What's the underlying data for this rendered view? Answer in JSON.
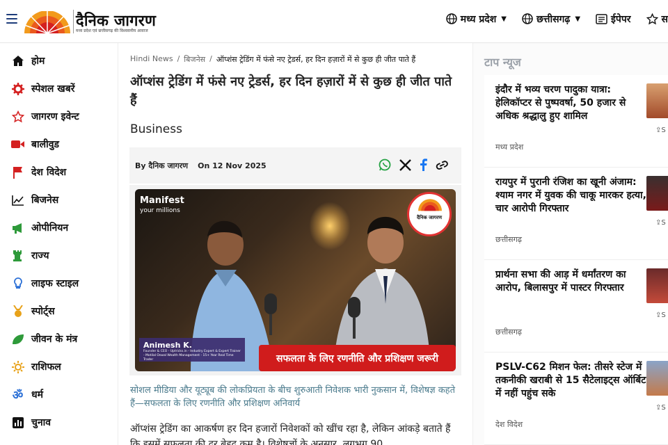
{
  "header": {
    "logo_text": "दैनिक जागरण",
    "logo_tagline": "मध्य प्रदेश एवं छत्तीसगढ़ की विश्वसनीय आवाज",
    "nav": [
      {
        "label": "मध्य प्रदेश",
        "icon": "globe-icon",
        "dropdown": true
      },
      {
        "label": "छत्तीसगढ़",
        "icon": "globe-icon",
        "dropdown": true
      },
      {
        "label": "ईपेपर",
        "icon": "newspaper-icon",
        "dropdown": false
      },
      {
        "label": "स",
        "icon": "star-icon",
        "dropdown": false
      }
    ]
  },
  "sidebar": {
    "items": [
      {
        "label": "होम",
        "icon": "home-icon",
        "color": "#111111"
      },
      {
        "label": "स्पेशल खबरें",
        "icon": "gear-icon",
        "color": "#d42020"
      },
      {
        "label": "जागरण इवेन्ट",
        "icon": "star-icon",
        "color": "#d42020"
      },
      {
        "label": "बालीवुड",
        "icon": "video-icon",
        "color": "#d42020"
      },
      {
        "label": "देश विदेश",
        "icon": "flag-icon",
        "color": "#d42020"
      },
      {
        "label": "बिजनेस",
        "icon": "chart-icon",
        "color": "#111111"
      },
      {
        "label": "ओपीनियन",
        "icon": "megaphone-icon",
        "color": "#2e9a3a"
      },
      {
        "label": "राज्य",
        "icon": "chess-icon",
        "color": "#2e9a3a"
      },
      {
        "label": "लाइफ स्टाइल",
        "icon": "bulb-icon",
        "color": "#2a6fd6"
      },
      {
        "label": "स्पोर्ट्स",
        "icon": "medal-icon",
        "color": "#e8a21a"
      },
      {
        "label": "जीवन के मंत्र",
        "icon": "leaf-icon",
        "color": "#2e9a3a"
      },
      {
        "label": "राशिफल",
        "icon": "sun-icon",
        "color": "#e8a21a"
      },
      {
        "label": "धर्म",
        "icon": "om-icon",
        "color": "#2a6fd6"
      },
      {
        "label": "चुनाव",
        "icon": "poll-icon",
        "color": "#111111"
      }
    ]
  },
  "article": {
    "breadcrumbs": [
      "Hindi News",
      "बिजनेस",
      "ऑप्शंस ट्रेडिंग में फंसे नए ट्रेडर्स, हर दिन हज़ारों में से कुछ ही जीत पाते हैं"
    ],
    "title": "ऑप्शंस ट्रेडिंग में फंसे नए ट्रेडर्स, हर दिन हज़ारों में से कुछ ही जीत पाते हैं",
    "category": "Business",
    "author": "By दैनिक जागरण",
    "date": "On 12 Nov 2025",
    "share_icons": [
      "whatsapp-icon",
      "x-icon",
      "facebook-icon",
      "link-icon"
    ],
    "hero": {
      "brand_line1": "Manifest",
      "brand_line2": "your millions",
      "logo_text": "दैनिक जागरण",
      "guest_name": "Animesh K.",
      "guest_desc": "Founder & CEO - Uptricks.in - Industry Expert & Expert Trainer - Motilal Oswal Wealth Management - 15+ Year Real Time Trader",
      "banner": "सफलता के लिए रणनीति और प्रशिक्षण जरूरी"
    },
    "caption": "सोशल मीडिया और यूट्यूब की लोकप्रियता के बीच शुरुआती निवेशक भारी नुकसान में, विशेषज्ञ कहते हैं—सफलता के लिए रणनीति और प्रशिक्षण अनिवार्य",
    "body": " ऑप्शंस ट्रेडिंग का आकर्षण हर दिन हजारों निवेशकों को खींच रहा है, लेकिन आंकड़े बताते हैं कि इसमें सफलता की दर बेहद कम है। विशेषज्ञों के अनुसार, लगभग 90"
  },
  "top_news": {
    "heading": "टाप न्यूज",
    "items": [
      {
        "title": "इंदौर में भव्य चरण पादुका यात्रा: हेलिकॉप्टर से पुष्पवर्षा, 50 हजार से अधिक श्रद्धालु हुए शामिल",
        "location": "मध्य प्रदेश",
        "share": "S"
      },
      {
        "title": "रायपुर में पुरानी रंजिश का खूनी अंजाम: श्याम नगर में युवक की चाकू मारकर हत्या, चार आरोपी गिरफ्तार",
        "location": "छत्तीसगढ़",
        "share": "S"
      },
      {
        "title": "प्रार्थना सभा की आड़ में धर्मांतरण का आरोप, बिलासपुर में पास्टर गिरफ्तार",
        "location": "छत्तीसगढ़",
        "share": "S"
      },
      {
        "title": "PSLV-C62 मिशन फेल: तीसरे स्टेज में तकनीकी खराबी से 15 सैटेलाइट्स ऑर्बिट में नहीं पहुंच सके",
        "location": "देश विदेश",
        "share": "S"
      }
    ]
  },
  "colors": {
    "brand_red": "#d01c1c",
    "nav_blue": "#1d3c7a",
    "caption": "#4a7a8c"
  }
}
